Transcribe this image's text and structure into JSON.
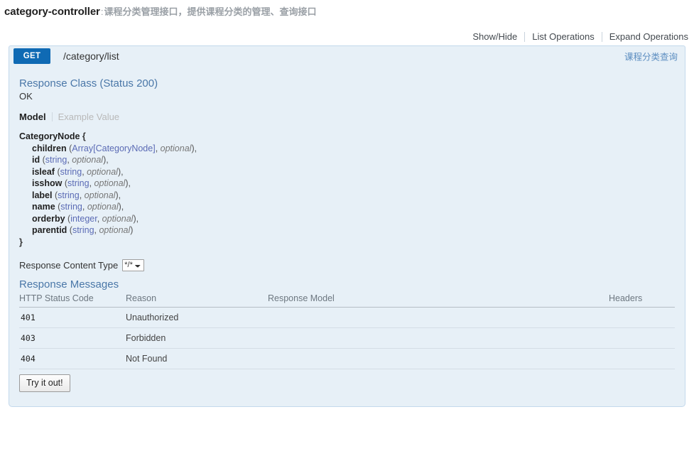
{
  "resource": {
    "name": "category-controller",
    "separator": ":",
    "description": "课程分类管理接口，提供课程分类的管理、查询接口"
  },
  "options_bar": {
    "show_hide": "Show/Hide",
    "list_operations": "List Operations",
    "expand_operations": "Expand Operations"
  },
  "operation": {
    "method": "GET",
    "path": "/category/list",
    "summary": "课程分类查询",
    "response_class_title": "Response Class (Status 200)",
    "response_class_status": "OK",
    "tabs": {
      "model": "Model",
      "example_value": "Example Value"
    },
    "model": {
      "title": "CategoryNode",
      "open_brace": "{",
      "close_brace": "}",
      "properties": [
        {
          "name": "children",
          "type": "Array[CategoryNode]",
          "optional": "optional",
          "trailing": ","
        },
        {
          "name": "id",
          "type": "string",
          "optional": "optional",
          "trailing": ","
        },
        {
          "name": "isleaf",
          "type": "string",
          "optional": "optional",
          "trailing": ","
        },
        {
          "name": "isshow",
          "type": "string",
          "optional": "optional",
          "trailing": ","
        },
        {
          "name": "label",
          "type": "string",
          "optional": "optional",
          "trailing": ","
        },
        {
          "name": "name",
          "type": "string",
          "optional": "optional",
          "trailing": ","
        },
        {
          "name": "orderby",
          "type": "integer",
          "optional": "optional",
          "trailing": ","
        },
        {
          "name": "parentid",
          "type": "string",
          "optional": "optional",
          "trailing": ""
        }
      ]
    },
    "content_type": {
      "label": "Response Content Type",
      "selected": "*/*",
      "options": [
        "*/*"
      ]
    },
    "response_messages": {
      "title": "Response Messages",
      "columns": [
        "HTTP Status Code",
        "Reason",
        "Response Model",
        "Headers"
      ],
      "rows": [
        {
          "code": "401",
          "reason": "Unauthorized",
          "model": "",
          "headers": ""
        },
        {
          "code": "403",
          "reason": "Forbidden",
          "model": "",
          "headers": ""
        },
        {
          "code": "404",
          "reason": "Not Found",
          "model": "",
          "headers": ""
        }
      ]
    },
    "submit_label": "Try it out!"
  },
  "colors": {
    "method_get": "#0f6ab4",
    "panel_bg": "#e7f0f7",
    "panel_border": "#c3d9ec",
    "heading_link": "#4a77a8",
    "summary": "#5b8dc0"
  }
}
